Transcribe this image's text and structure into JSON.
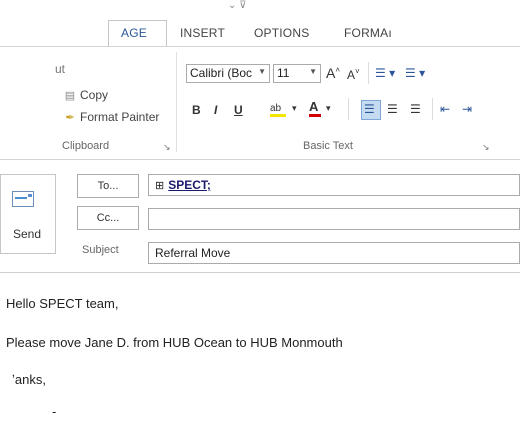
{
  "title_bar": {
    "glyphs": "⌄  ⊽"
  },
  "tabs": [
    {
      "label": "AGE",
      "active": true
    },
    {
      "label": "INSERT",
      "active": false
    },
    {
      "label": "OPTIONS",
      "active": false
    },
    {
      "label": "FORMAı",
      "active": false
    }
  ],
  "clipboard": {
    "cut_label": "ut",
    "copy_label": "Copy",
    "format_painter_label": "Format Painter",
    "group_label": "Clipboard"
  },
  "basic_text": {
    "font_name": "Calibri (Boc",
    "font_size": "11",
    "group_label": "Basic Text",
    "bold": "B",
    "italic": "I",
    "underline": "U"
  },
  "header": {
    "send_label": "Send",
    "to_button": "To...",
    "cc_button": "Cc...",
    "subject_label": "Subject",
    "to_value": "SPECT;",
    "to_expand_glyph": "⊞",
    "cc_value": "",
    "subject_value": "Referral Move"
  },
  "body": {
    "line1": "Hello SPECT team,",
    "line2": "Please move Jane D. from HUB Ocean to HUB Monmouth",
    "line3": "ʼanks,",
    "line4": "-"
  }
}
